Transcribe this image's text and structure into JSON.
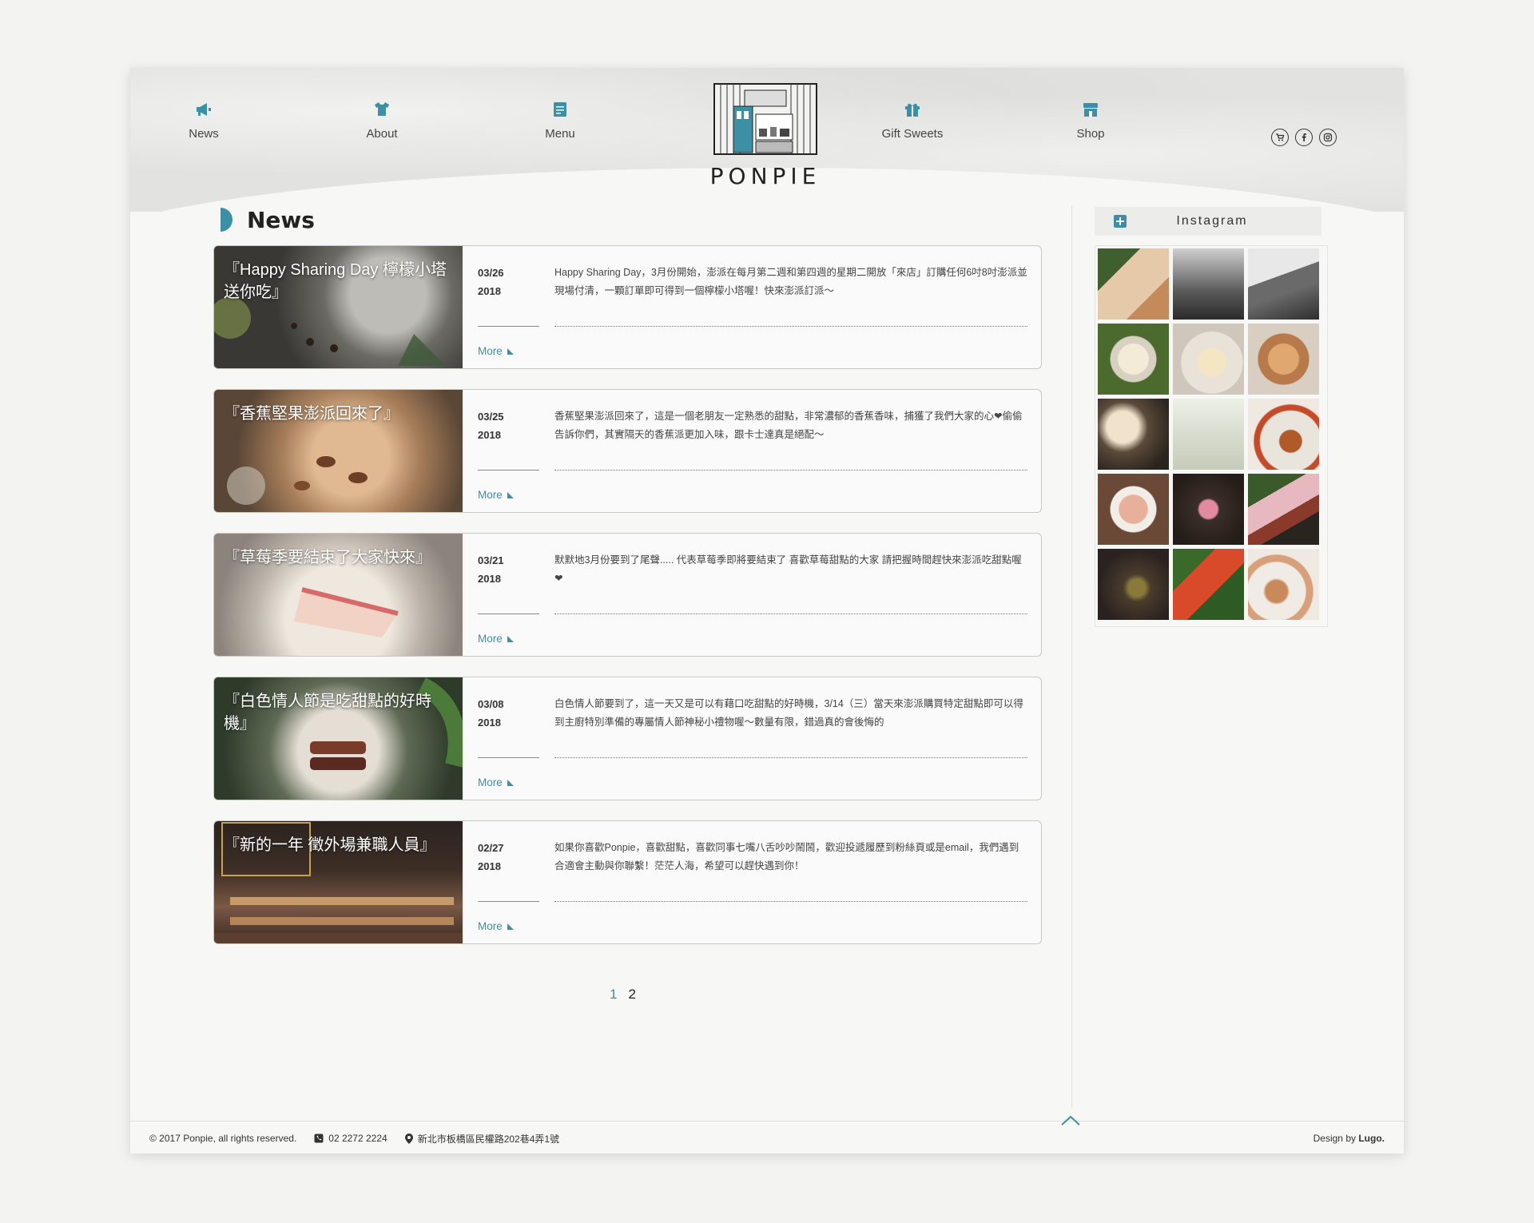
{
  "nav": {
    "news": "News",
    "about": "About",
    "menu": "Menu",
    "gift": "Gift Sweets",
    "shop": "Shop"
  },
  "logo": {
    "name": "PONPIE"
  },
  "section": {
    "title": "News"
  },
  "news": [
    {
      "caption": "『Happy Sharing Day 檸檬小塔送你吃』",
      "date_md": "03/26",
      "date_y": "2018",
      "text": "Happy Sharing Day，3月份開始，澎派在每月第二週和第四週的星期二開放「來店」訂購任何6吋8吋澎派並現場付清，一顆訂單即可得到一個檸檬小塔喔！快來澎派訂派～",
      "more": "More"
    },
    {
      "caption": "『香蕉堅果澎派回來了』",
      "date_md": "03/25",
      "date_y": "2018",
      "text": "香蕉堅果澎派回來了，這是一個老朋友一定熟悉的甜點，非常濃郁的香蕉香味，捕獲了我們大家的心❤偷偷告訴你們，其實隔天的香蕉派更加入味，跟卡士達真是絕配～",
      "more": "More"
    },
    {
      "caption": "『草莓季要結束了大家快來』",
      "date_md": "03/21",
      "date_y": "2018",
      "text": "默默地3月份要到了尾聲..... 代表草莓季即將要結束了 喜歡草莓甜點的大家 請把握時間趕快來澎派吃甜點喔❤",
      "more": "More"
    },
    {
      "caption": "『白色情人節是吃甜點的好時機』",
      "date_md": "03/08",
      "date_y": "2018",
      "text": "白色情人節要到了，這一天又是可以有藉口吃甜點的好時機，3/14（三）當天來澎派購買特定甜點即可以得到主廚特別準備的專屬情人節神秘小禮物喔～數量有限，錯過真的會後悔的",
      "more": "More"
    },
    {
      "caption": "『新的一年 徵外場兼職人員』",
      "date_md": "02/27",
      "date_y": "2018",
      "text": "如果你喜歡Ponpie，喜歡甜點，喜歡同事七嘴八舌吵吵鬧鬧，歡迎投遞履歷到粉絲頁或是email，我們遇到合適會主動與你聯繫！茫茫人海，希望可以趕快遇到你！",
      "more": "More"
    }
  ],
  "pager": {
    "p1": "1",
    "p2": "2"
  },
  "instagram": {
    "title": "Instagram"
  },
  "footer": {
    "copyright": "© 2017 Ponpie, all rights reserved.",
    "phone": "02 2272 2224",
    "address": "新北市板橋區民權路202巷4弄1號",
    "design_prefix": "Design by",
    "design_name": "Lugo."
  },
  "colors": {
    "accent": "#3d8fa6",
    "background": "#f7f7f6"
  }
}
